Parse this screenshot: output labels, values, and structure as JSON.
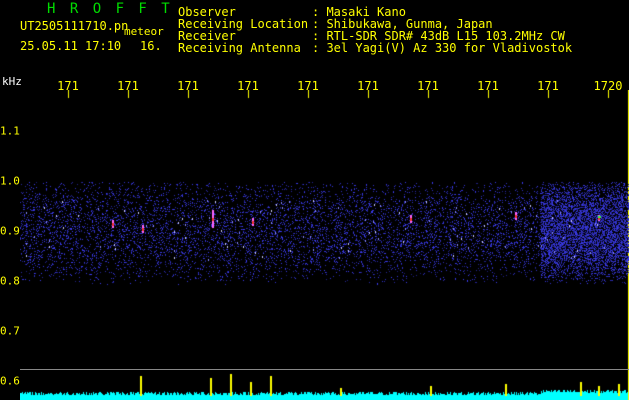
{
  "header": {
    "app_title": "H R O F F T",
    "filename": "UT2505111710.pn",
    "tag": "meteor",
    "datetime": "25.05.11 17:10",
    "counter": "16."
  },
  "info": [
    {
      "label": "Observer",
      "value": ": Masaki Kano"
    },
    {
      "label": "Receiving Location",
      "value": ": Shibukawa, Gunma, Japan"
    },
    {
      "label": "Receiver",
      "value": ": RTL-SDR SDR# 43dB L15 103.2MHz CW"
    },
    {
      "label": "Receiving Antenna",
      "value": ": 3el Yagi(V) Az 330 for Vladivostok"
    }
  ],
  "axes": {
    "y_unit": "kHz",
    "x_ticks": [
      "171",
      "171",
      "171",
      "171",
      "171",
      "171",
      "171",
      "171",
      "171",
      "1720"
    ],
    "y_ticks": [
      "1.1",
      "1.0",
      "0.9",
      "0.8",
      "0.7",
      "0.6"
    ]
  },
  "colors": {
    "background": "#000000",
    "title": "#00dd00",
    "info_text": "#ffff00",
    "axis_text": "#ffff00",
    "grid": "#ffff00",
    "noise": "#2a2ad0",
    "signal": "#ff3333",
    "bottom_trace": "#00ffff",
    "bottom_spike": "#ffff00"
  }
}
